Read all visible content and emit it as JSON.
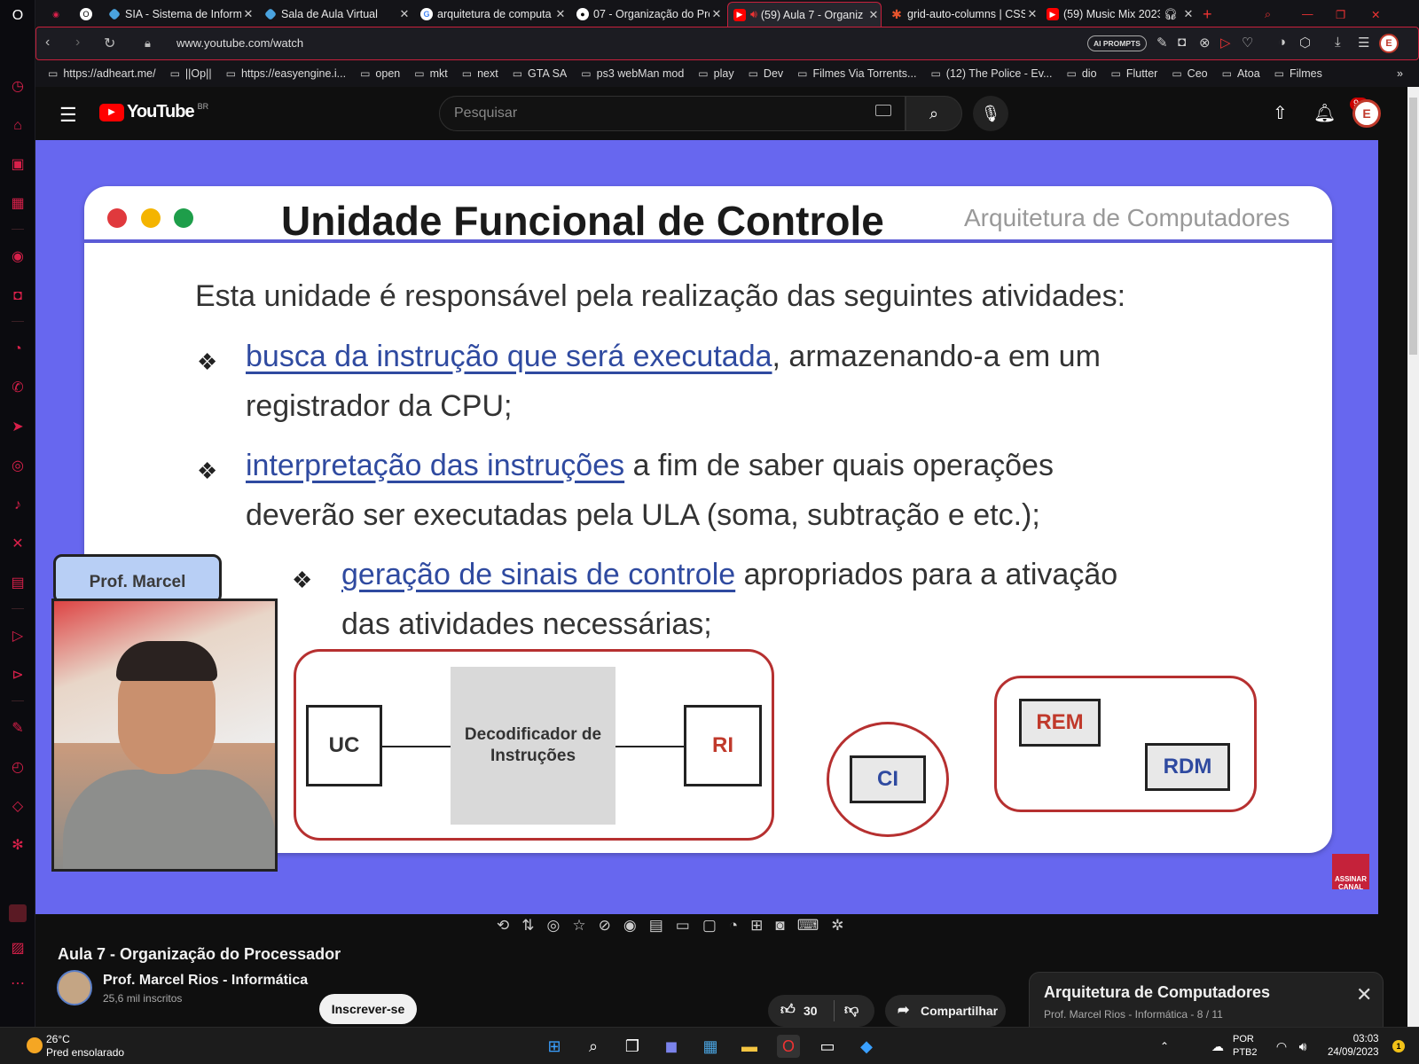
{
  "browser": {
    "tabs": [
      {
        "title": "SIA - Sistema de Inform",
        "favicon": "diamond-icon",
        "color": "#4aa3df"
      },
      {
        "title": "Sala de Aula Virtual",
        "favicon": "diamond-icon",
        "color": "#4aa3df"
      },
      {
        "title": "arquitetura de computa",
        "favicon": "google-icon",
        "color": "#ffffff"
      },
      {
        "title": "07 - Organização do Pro",
        "favicon": "github-icon",
        "color": "#ffffff"
      },
      {
        "title": "(59) Aula 7 - Organiz",
        "favicon": "youtube-icon",
        "color": "#ff0000",
        "active": true
      },
      {
        "title": "grid-auto-columns | CSS",
        "favicon": "asterisk-icon",
        "color": "#e8552d"
      },
      {
        "title": "(59) Music Mix 2023",
        "favicon": "youtube-icon",
        "color": "#ff0000"
      }
    ],
    "url": "www.youtube.com/watch",
    "ai_prompts": "AI PROMPTS",
    "bookmarks": [
      "https://adheart.me/",
      "||Op||",
      "https://easyengine.i...",
      "open",
      "mkt",
      "next",
      "GTA SA",
      "ps3 webMan mod",
      "play",
      "Dev",
      "Filmes Via Torrents...",
      "(12) The Police - Ev...",
      "dio",
      "Flutter",
      "Ceo",
      "Atoa",
      "Filmes"
    ]
  },
  "youtube": {
    "logo_text": "YouTube",
    "region": "BR",
    "search_placeholder": "Pesquisar",
    "notifications": "9+",
    "avatar_letter": "E"
  },
  "slide": {
    "title": "Unidade Funcional de Controle",
    "subtitle": "Arquitetura de Computadores",
    "intro": "Esta unidade é responsável pela realização das seguintes atividades:",
    "bullet1_link": "busca da instrução que será executada",
    "bullet1_rest": ", armazenando-a em um",
    "bullet1_line2": "registrador da CPU;",
    "bullet2_link": "interpretação das instruções",
    "bullet2_rest": " a fim de saber quais operações",
    "bullet2_line2": "deverão ser executadas pela ULA (soma, subtração e etc.);",
    "bullet3_link": "geração de sinais de controle",
    "bullet3_rest": " apropriados para a ativação",
    "bullet3_line2": "das atividades necessárias;",
    "diagram": {
      "uc": "UC",
      "decoder": "Decodificador de Instruções",
      "ri": "RI",
      "ci": "CI",
      "rem": "REM",
      "rdm": "RDM"
    },
    "cam_label": "Prof. Marcel",
    "subscribe_badge": "ASSINAR CANAL"
  },
  "video": {
    "title": "Aula 7 - Organização do Processador",
    "channel": "Prof. Marcel Rios - Informática",
    "subscribers": "25,6 mil inscritos",
    "subscribe_label": "Inscrever-se",
    "likes": "30",
    "share_label": "Compartilhar"
  },
  "playlist": {
    "title": "Arquitetura de Computadores",
    "channel": "Prof. Marcel Rios - Informática",
    "position": "8 / 11"
  },
  "taskbar": {
    "temperature": "26°C",
    "weather": "Pred ensolarado",
    "lang1": "POR",
    "lang2": "PTB2",
    "time": "03:03",
    "date": "24/09/2023",
    "notifications": "1"
  }
}
